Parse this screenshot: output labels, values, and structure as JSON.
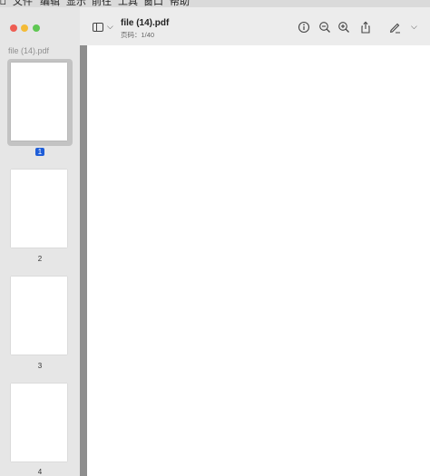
{
  "menubar": {
    "items": [
      "文件",
      "编辑",
      "显示",
      "前往",
      "工具",
      "窗口",
      "帮助"
    ]
  },
  "sidebar": {
    "title": "file (14).pdf",
    "thumbnails": [
      {
        "page": "1",
        "selected": true
      },
      {
        "page": "2",
        "selected": false
      },
      {
        "page": "3",
        "selected": false
      },
      {
        "page": "4",
        "selected": false
      }
    ]
  },
  "toolbar": {
    "title": "file (14).pdf",
    "subtitle": "页码：1/40",
    "icons": [
      "sidebar-toggle-icon",
      "chevron-down-icon",
      "info-icon",
      "zoom-out-icon",
      "zoom-in-icon",
      "share-icon",
      "markup-pen-icon",
      "chevron-down-icon"
    ]
  },
  "colors": {
    "selected_badge": "#1f5ed8",
    "close": "#ee5d53",
    "minimize": "#f4bb37",
    "zoom": "#5fc753"
  }
}
